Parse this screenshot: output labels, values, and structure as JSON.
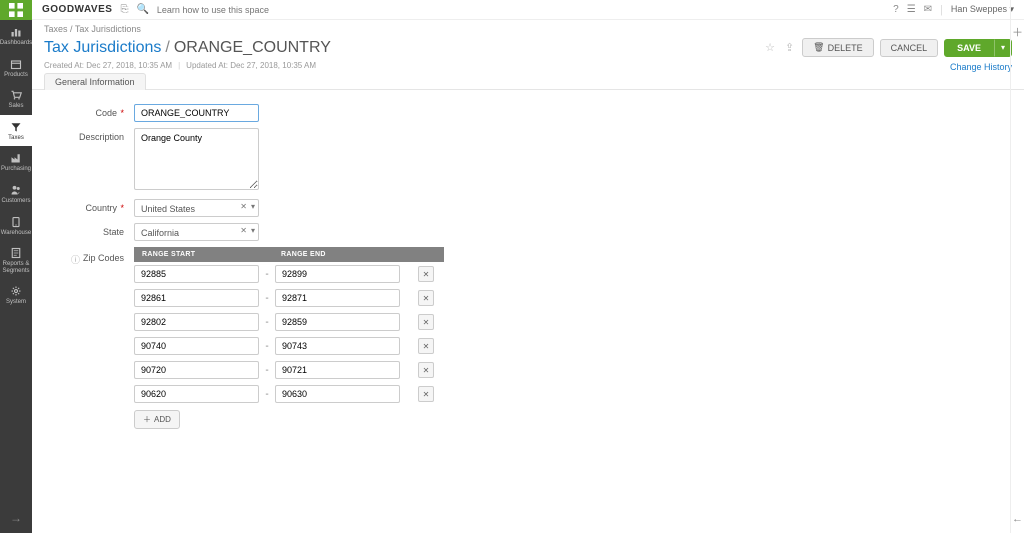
{
  "brand": "GOODWAVES",
  "search_placeholder": "Learn how to use this space",
  "user_name": "Han Sweppes",
  "nav": [
    {
      "key": "dashboards",
      "label": "Dashboards",
      "icon": "chart"
    },
    {
      "key": "products",
      "label": "Products",
      "icon": "box"
    },
    {
      "key": "sales",
      "label": "Sales",
      "icon": "cart"
    },
    {
      "key": "taxes",
      "label": "Taxes",
      "icon": "filter",
      "active": true
    },
    {
      "key": "purchasing",
      "label": "Purchasing",
      "icon": "factory"
    },
    {
      "key": "customers",
      "label": "Customers",
      "icon": "users"
    },
    {
      "key": "warehouse",
      "label": "Warehouse",
      "icon": "tablet"
    },
    {
      "key": "reports",
      "label": "Reports & Segments",
      "icon": "report"
    },
    {
      "key": "system",
      "label": "System",
      "icon": "gear"
    }
  ],
  "breadcrumb": {
    "root": "Taxes",
    "leaf": "Tax Jurisdictions"
  },
  "title": {
    "parent": "Tax Jurisdictions",
    "name": "ORANGE_COUNTRY"
  },
  "actions": {
    "delete": "DELETE",
    "cancel": "CANCEL",
    "save": "SAVE"
  },
  "meta": {
    "created": "Created At: Dec 27, 2018, 10:35 AM",
    "updated": "Updated At: Dec 27, 2018, 10:35 AM"
  },
  "change_history": "Change History",
  "tab": "General Information",
  "labels": {
    "code": "Code",
    "description": "Description",
    "country": "Country",
    "state": "State",
    "zip": "Zip Codes"
  },
  "form": {
    "code": "ORANGE_COUNTRY",
    "description": "Orange County",
    "country": "United States",
    "state": "California"
  },
  "zip_headers": {
    "start": "RANGE START",
    "end": "RANGE END"
  },
  "zips": [
    {
      "start": "92885",
      "end": "92899"
    },
    {
      "start": "92861",
      "end": "92871"
    },
    {
      "start": "92802",
      "end": "92859"
    },
    {
      "start": "90740",
      "end": "90743"
    },
    {
      "start": "90720",
      "end": "90721"
    },
    {
      "start": "90620",
      "end": "90630"
    }
  ],
  "add_label": "ADD"
}
